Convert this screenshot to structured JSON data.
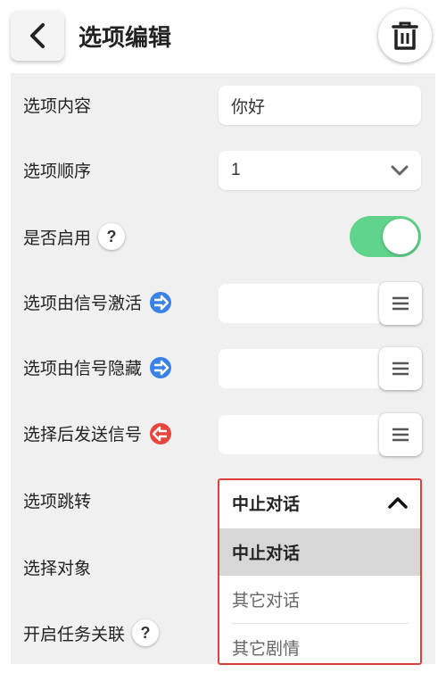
{
  "header": {
    "title": "选项编辑"
  },
  "form": {
    "option_content": {
      "label": "选项内容",
      "value": "你好"
    },
    "option_order": {
      "label": "选项顺序",
      "value": "1"
    },
    "enabled": {
      "label": "是否启用",
      "help": "?",
      "on": true
    },
    "activate_signal": {
      "label": "选项由信号激活"
    },
    "hide_signal": {
      "label": "选项由信号隐藏"
    },
    "send_signal": {
      "label": "选择后发送信号"
    },
    "jump": {
      "label": "选项跳转"
    },
    "target": {
      "label": "选择对象"
    },
    "task_link": {
      "label": "开启任务关联",
      "help": "?"
    }
  },
  "dropdown": {
    "selected": "中止对话",
    "options": [
      "中止对话",
      "其它对话",
      "其它剧情"
    ]
  },
  "colors": {
    "toggle_on": "#5fd48a",
    "signal_in": "#3b82e8",
    "signal_out": "#e8453c",
    "dropdown_border": "#e0403a"
  }
}
